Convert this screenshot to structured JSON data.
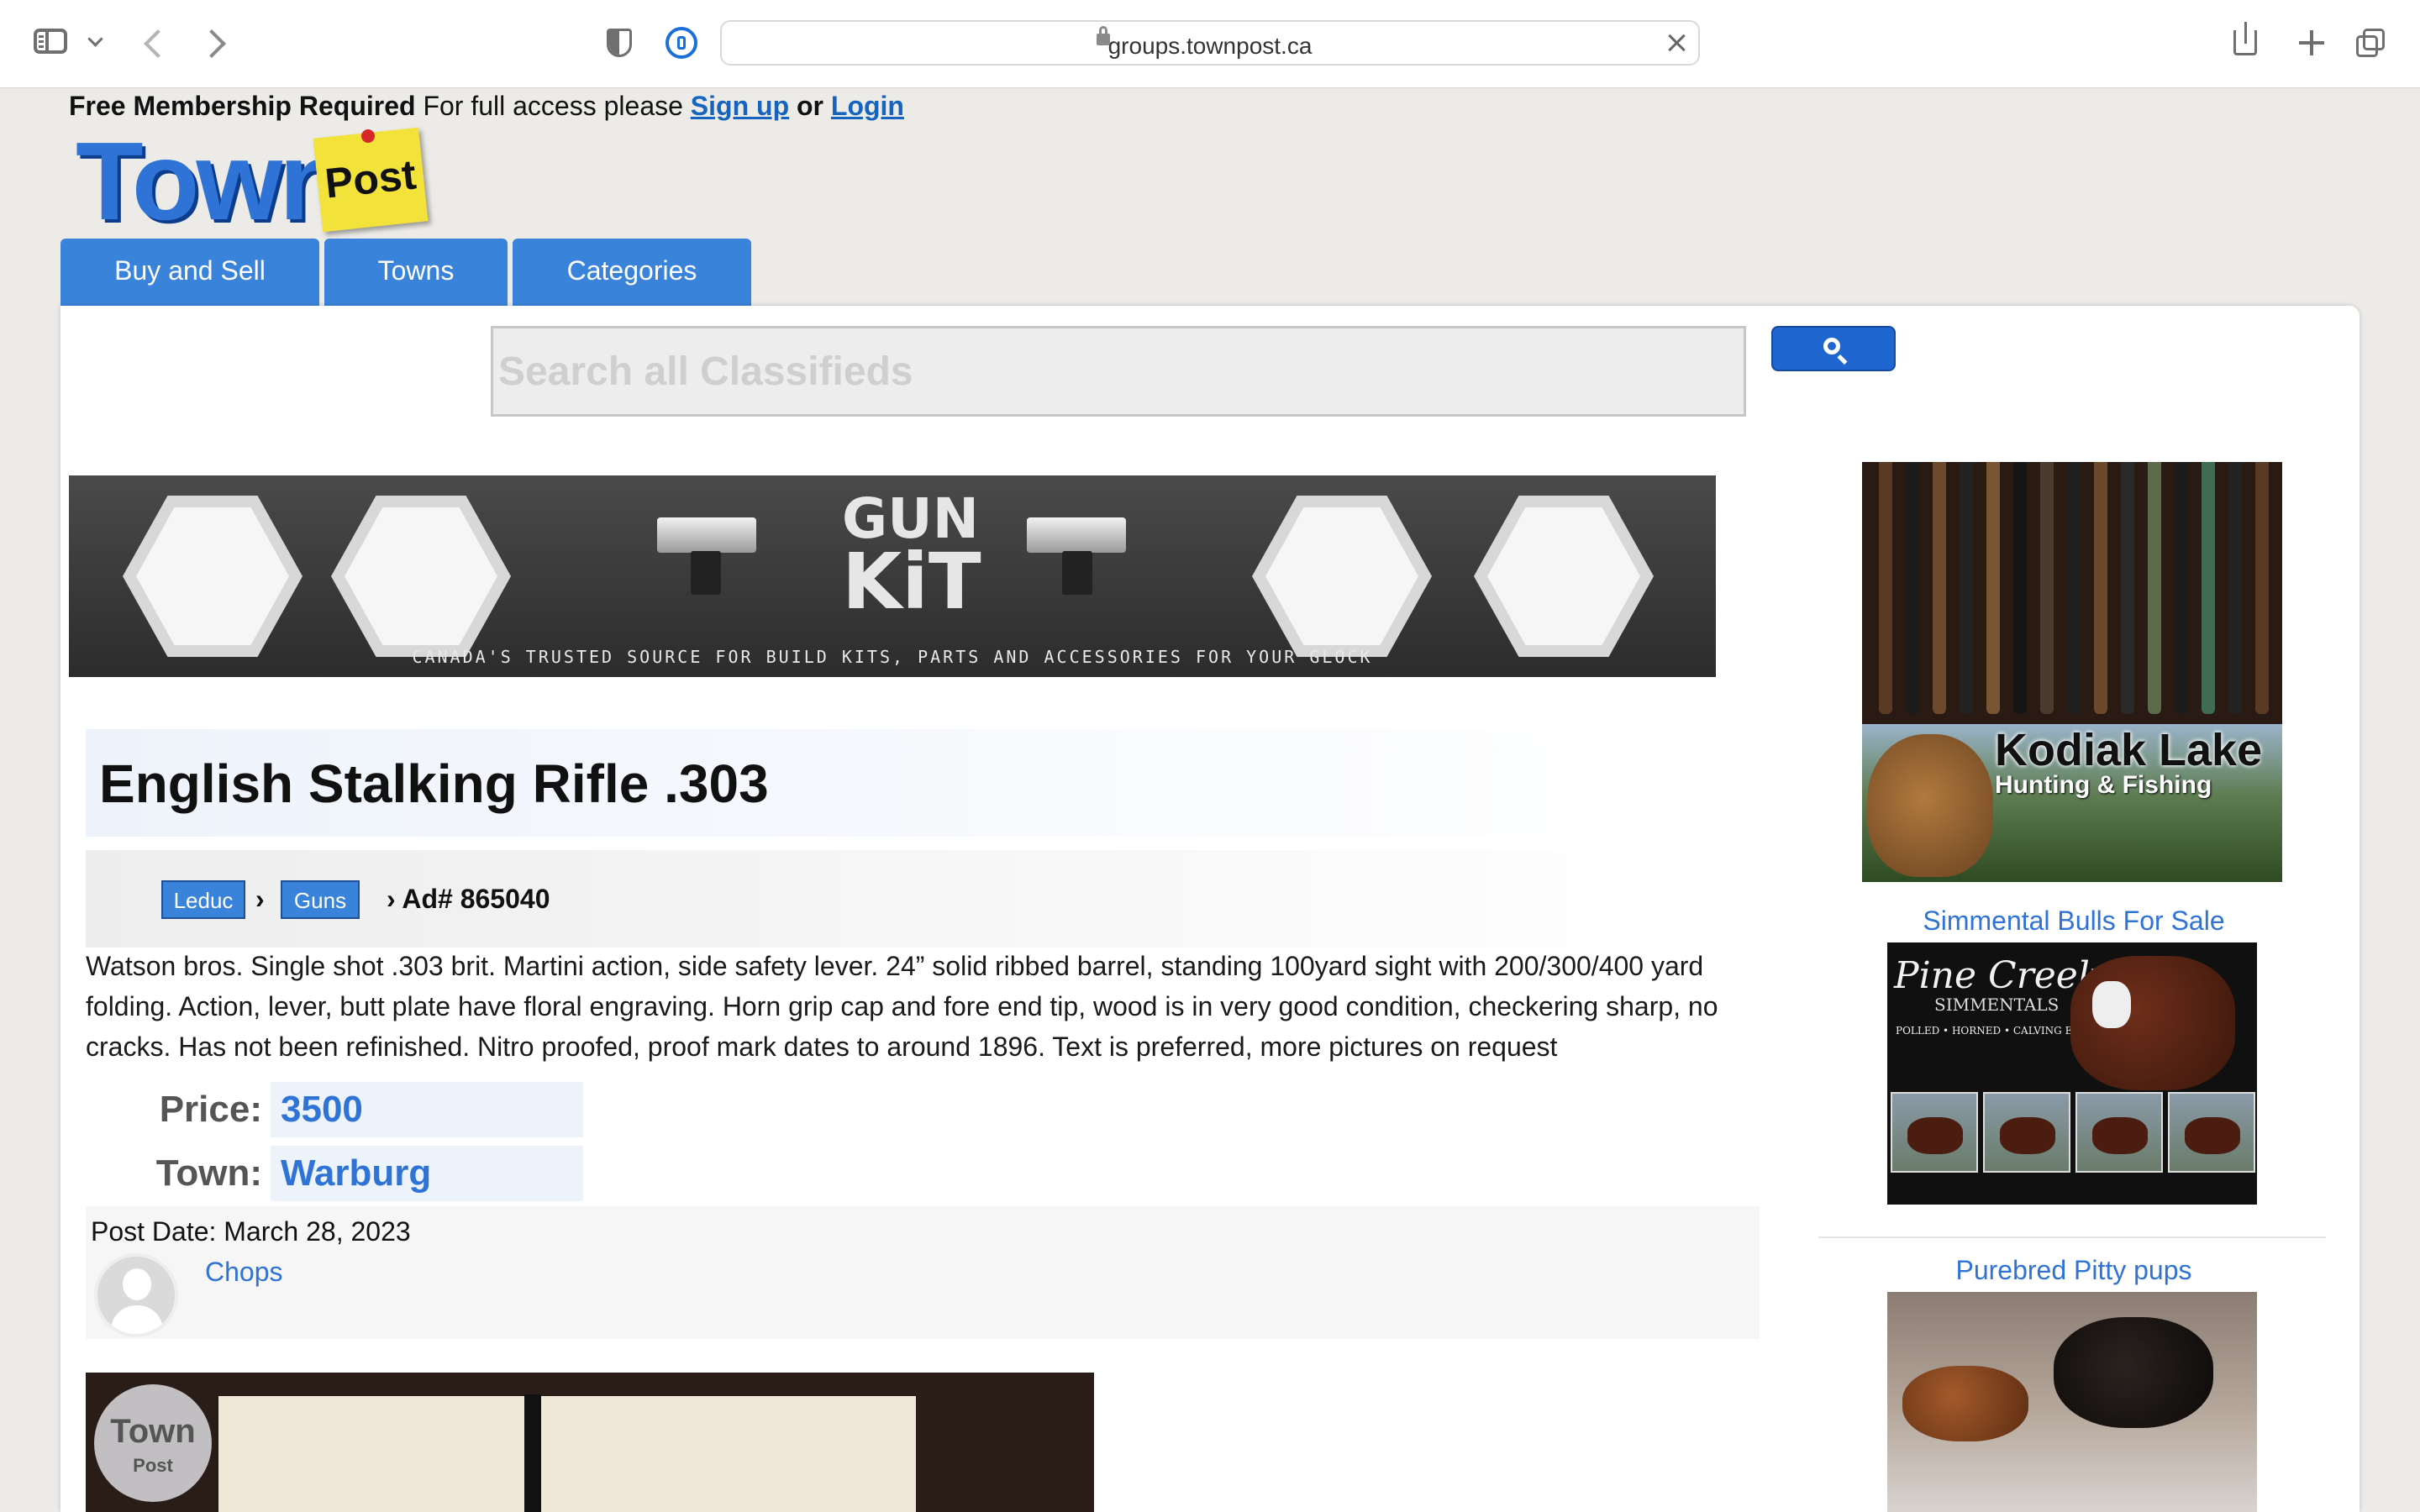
{
  "browser": {
    "url": "groups.townpost.ca"
  },
  "site": {
    "membership_lead": "Free Membership Required",
    "membership_text": " For full access please ",
    "signup_label": "Sign up",
    "or_label": " or ",
    "login_label": "Login",
    "logo_town": "Town",
    "logo_post": "Post",
    "nav": [
      {
        "label": "Buy and Sell"
      },
      {
        "label": "Towns"
      },
      {
        "label": "Categories"
      }
    ],
    "search_placeholder": "Search all Classifieds"
  },
  "banner": {
    "gk_line1": "GUN",
    "gk_line2": "KiT",
    "tagline": "CANADA'S TRUSTED SOURCE FOR BUILD KITS, PARTS AND ACCESSORIES FOR YOUR GLOCK"
  },
  "ad": {
    "title": "English Stalking Rifle .303",
    "breadcrumb": {
      "town": "Leduc",
      "category": "Guns",
      "sep": "›",
      "ad_number": "› Ad# 865040"
    },
    "description": "Watson bros. Single shot .303 brit. Martini action, side safety lever. 24” solid ribbed barrel, standing 100yard sight with 200/300/400 yard folding. Action, lever, butt plate have floral engraving. Horn grip cap and fore end tip, wood is in very good condition, checkering sharp, no cracks. Has not been refinished. Nitro proofed, proof mark dates to around 1896. Text is preferred, more pictures on request",
    "price_label": "Price:",
    "price": "3500",
    "town_label": "Town:",
    "town": "Warburg",
    "post_date": "Post Date: March 28, 2023",
    "poster": "Chops",
    "watermark_town": "Town",
    "watermark_post": "Post"
  },
  "sidebar": {
    "kodiak_title": "Kodiak Lake",
    "kodiak_sub": "Hunting & Fishing",
    "ad1_title": "Simmental Bulls For Sale",
    "ad1_brand": "Pine Creek",
    "ad1_brand_sub": "SIMMENTALS",
    "ad1_tagline": "POLLED • HORNED • CALVING EASE • POWER BULLS",
    "ad2_title": "Purebred Pitty pups"
  }
}
